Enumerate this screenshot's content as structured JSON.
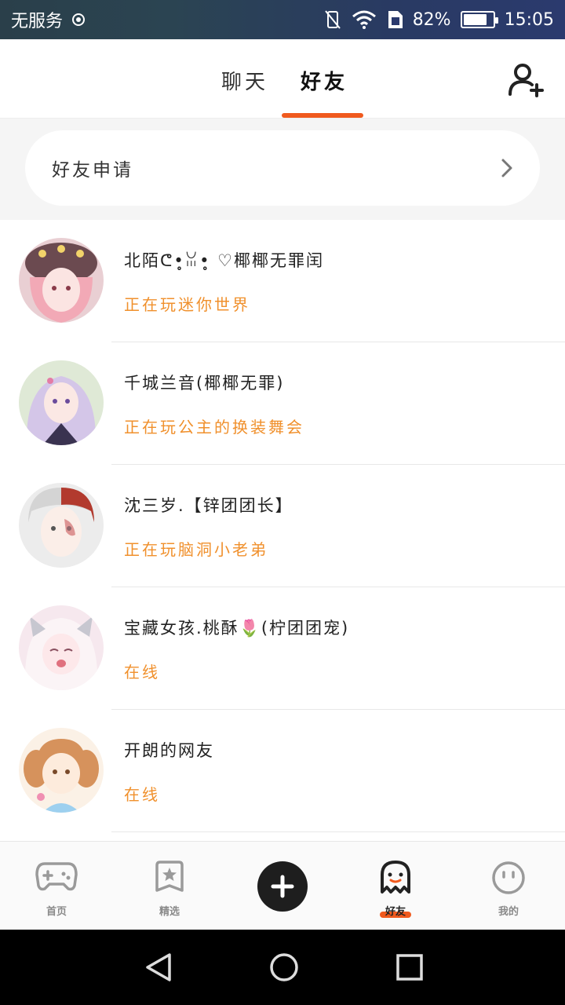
{
  "status_bar": {
    "carrier": "无服务",
    "battery_percent": "82%",
    "battery_level": 0.82,
    "time": "15:05"
  },
  "header": {
    "tabs": [
      {
        "label": "聊天",
        "active": false
      },
      {
        "label": "好友",
        "active": true
      }
    ],
    "add_friend_icon": "add-user-icon",
    "accent_color": "#f05a1e"
  },
  "friend_request": {
    "label": "好友申请"
  },
  "friends": [
    {
      "name": "北陌ᕦ•̥̥ꈍ•̥̥ ♡椰椰无罪闰",
      "status": "正在玩迷你世界"
    },
    {
      "name": "千城兰音(椰椰无罪)",
      "status": "正在玩公主的换装舞会"
    },
    {
      "name": "沈三岁.【锌团团长】",
      "status": "正在玩脑洞小老弟"
    },
    {
      "name": "宝藏女孩.桃酥🌷(柠团团宠)",
      "status": "在线"
    },
    {
      "name": "开朗的网友",
      "status": "在线"
    }
  ],
  "bottom_nav": {
    "items": [
      {
        "label": "首页",
        "icon": "gamepad-icon",
        "active": false
      },
      {
        "label": "精选",
        "icon": "star-bookmark-icon",
        "active": false
      },
      {
        "label": "",
        "icon": "plus-icon",
        "active": false
      },
      {
        "label": "好友",
        "icon": "ghost-icon",
        "active": true
      },
      {
        "label": "我的",
        "icon": "smiley-icon",
        "active": false
      }
    ]
  },
  "status_color": "#f0902c"
}
